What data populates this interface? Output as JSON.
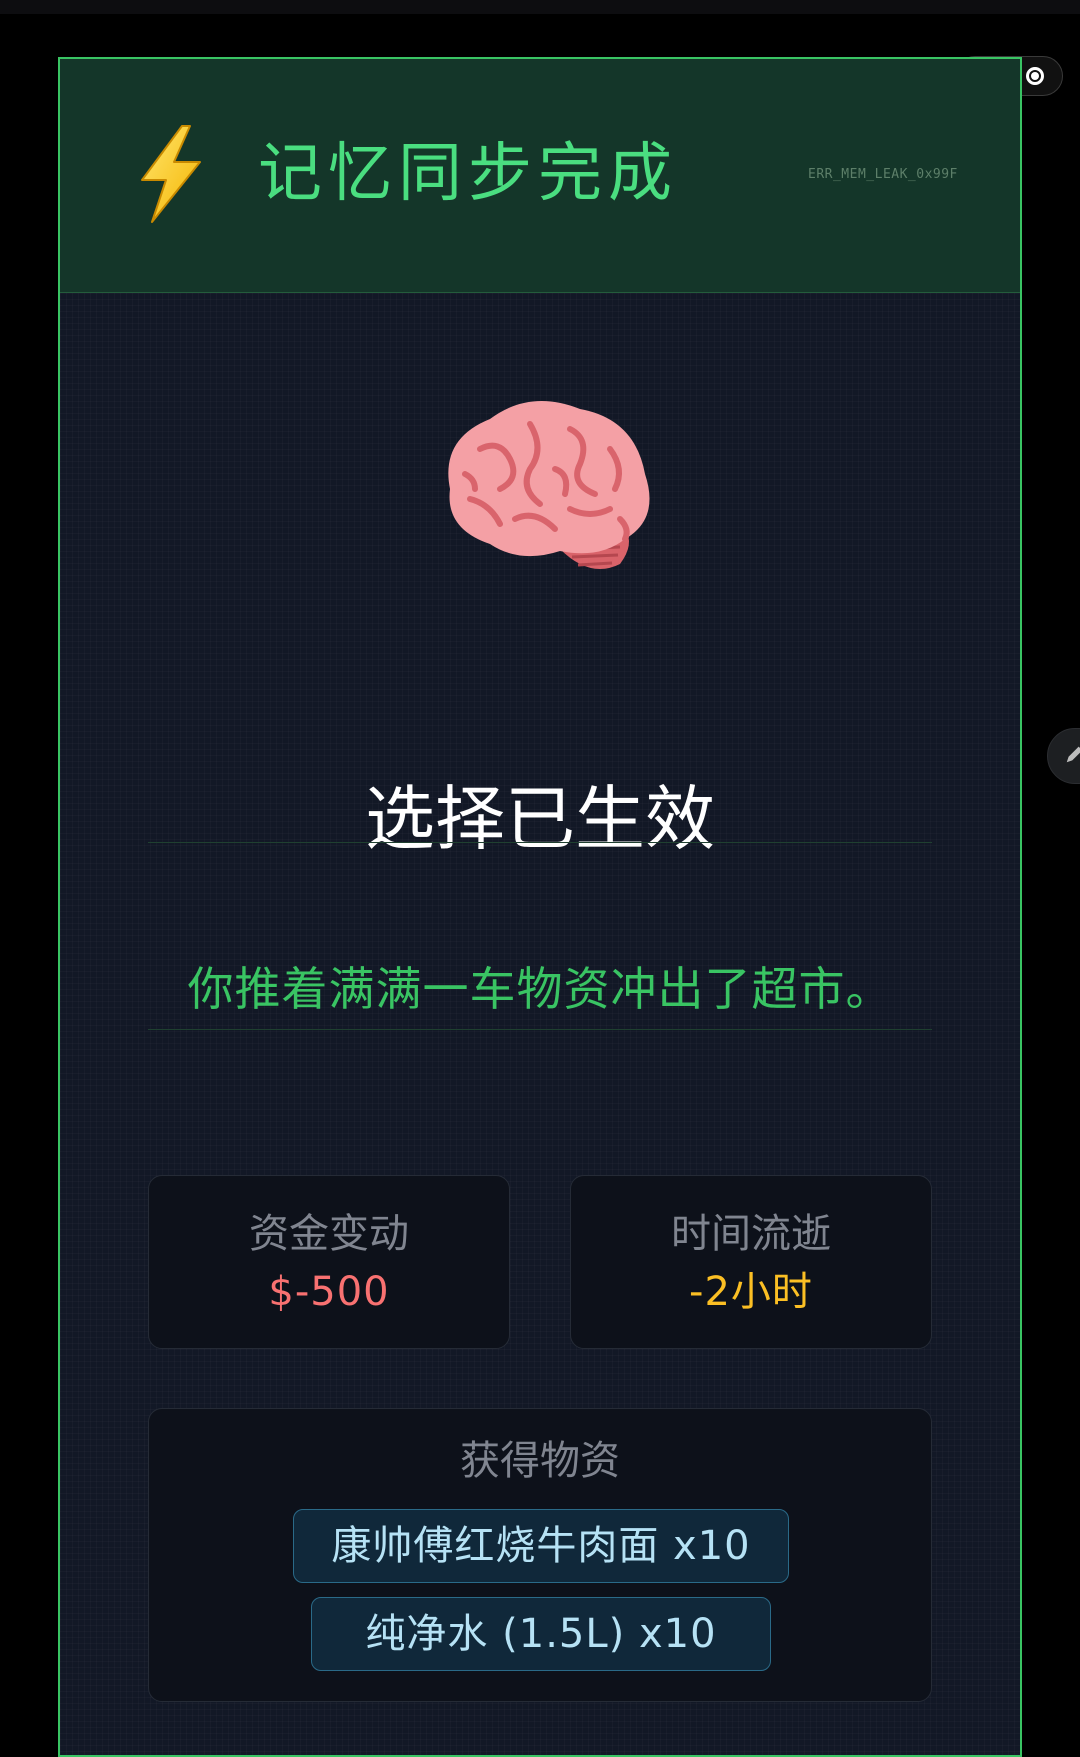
{
  "header": {
    "title": "记忆同步完成",
    "error_code": "ERR_MEM_LEAK_0x99F",
    "icon": "lightning-bolt-icon"
  },
  "illustration": {
    "icon": "brain-icon"
  },
  "result": {
    "heading": "选择已生效",
    "message": "你推着满满一车物资冲出了超市。"
  },
  "stats": [
    {
      "label": "资金变动",
      "value": "$-500",
      "color": "#f87171"
    },
    {
      "label": "时间流逝",
      "value": "-2小时",
      "color": "#fbbf24"
    }
  ],
  "loot": {
    "title": "获得物资",
    "items": [
      {
        "label": "康帅傅红烧牛肉面 x10"
      },
      {
        "label": "纯净水 (1.5L) x10"
      }
    ]
  },
  "colors": {
    "accent": "#4ade80",
    "border": "#39c463",
    "header_bg": "#143629",
    "card_bg": "#121826"
  }
}
